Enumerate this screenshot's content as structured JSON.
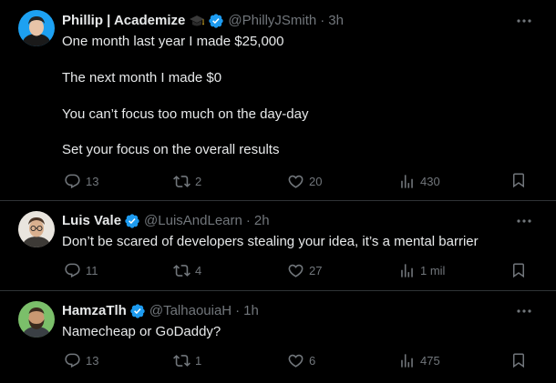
{
  "tweets": [
    {
      "display_name": "Phillip | Academize",
      "handle": "@PhillyJSmith",
      "separator": "·",
      "time": "3h",
      "lines": [
        "One month last year I made $25,000",
        "The next month I made $0",
        "You can’t focus too much on the day-day",
        "Set your focus on the overall results"
      ],
      "replies": "13",
      "reposts": "2",
      "likes": "20",
      "views": "430",
      "avatar_icon": "avatar-dark-hair-person",
      "badge_icon": "graduation-cap-icon"
    },
    {
      "display_name": "Luis Vale",
      "handle": "@LuisAndLearn",
      "separator": "·",
      "time": "2h",
      "lines": [
        "Don’t be scared of developers stealing your idea, it’s a mental barrier"
      ],
      "replies": "11",
      "reposts": "4",
      "likes": "27",
      "views": "1 mil",
      "avatar_icon": "avatar-glasses-person"
    },
    {
      "display_name": "HamzaTlh",
      "handle": "@TalhaouiaH",
      "separator": "·",
      "time": "1h",
      "lines": [
        "Namecheap or GoDaddy?"
      ],
      "replies": "13",
      "reposts": "1",
      "likes": "6",
      "views": "475",
      "avatar_icon": "avatar-bearded-person"
    }
  ],
  "colors": {
    "background": "#000000",
    "text": "#e7e9ea",
    "secondary": "#71767b",
    "divider": "#2f3336",
    "verified": "#1d9bf0"
  }
}
